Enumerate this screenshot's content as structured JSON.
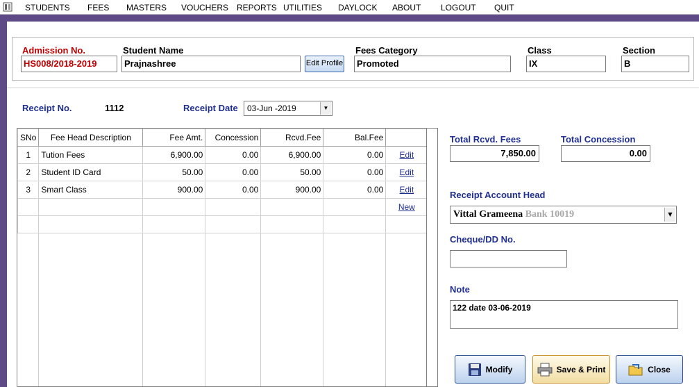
{
  "menu": [
    "STUDENTS",
    "FEES",
    "MASTERS",
    "VOUCHERS",
    "REPORTS",
    "UTILITIES",
    "DAYLOCK",
    "ABOUT",
    "LOGOUT",
    "QUIT"
  ],
  "header": {
    "admission_label": "Admission No.",
    "admission_value": "HS008/2018-2019",
    "student_label": "Student Name",
    "student_value": "Prajnashree",
    "edit_profile_label": "Edit Profile",
    "category_label": "Fees Category",
    "category_value": "Promoted",
    "class_label": "Class",
    "class_value": "IX",
    "section_label": "Section",
    "section_value": "B"
  },
  "receipt": {
    "no_label": "Receipt No.",
    "no_value": "1112",
    "date_label": "Receipt Date",
    "date_value": "03-Jun -2019"
  },
  "grid": {
    "columns": [
      "SNo",
      "Fee Head Description",
      "Fee Amt.",
      "Concession",
      "Rcvd.Fee",
      "Bal.Fee",
      ""
    ],
    "rows": [
      {
        "sno": "1",
        "desc": "Tution Fees",
        "amt": "6,900.00",
        "conc": "0.00",
        "rcvd": "6,900.00",
        "bal": "0.00",
        "action": "Edit"
      },
      {
        "sno": "2",
        "desc": "Student ID Card",
        "amt": "50.00",
        "conc": "0.00",
        "rcvd": "50.00",
        "bal": "0.00",
        "action": "Edit"
      },
      {
        "sno": "3",
        "desc": "Smart Class",
        "amt": "900.00",
        "conc": "0.00",
        "rcvd": "900.00",
        "bal": "0.00",
        "action": "Edit"
      }
    ],
    "new_label": "New"
  },
  "totals": {
    "rcvd_label": "Total Rcvd. Fees",
    "rcvd_value": "7,850.00",
    "concession_label": "Total Concession",
    "concession_value": "0.00"
  },
  "account": {
    "label": "Receipt Account Head",
    "value_main": "Vittal Grameena",
    "value_faded": "Bank 10019"
  },
  "cheque": {
    "label": "Cheque/DD No.",
    "value": ""
  },
  "note": {
    "label": "Note",
    "value": "122 date 03-06-2019"
  },
  "buttons": {
    "modify": "Modify",
    "save_print": "Save & Print",
    "close": "Close"
  },
  "colors": {
    "frame": "#5e4a86",
    "label_navy": "#1f2f8f",
    "label_red": "#c00000"
  }
}
